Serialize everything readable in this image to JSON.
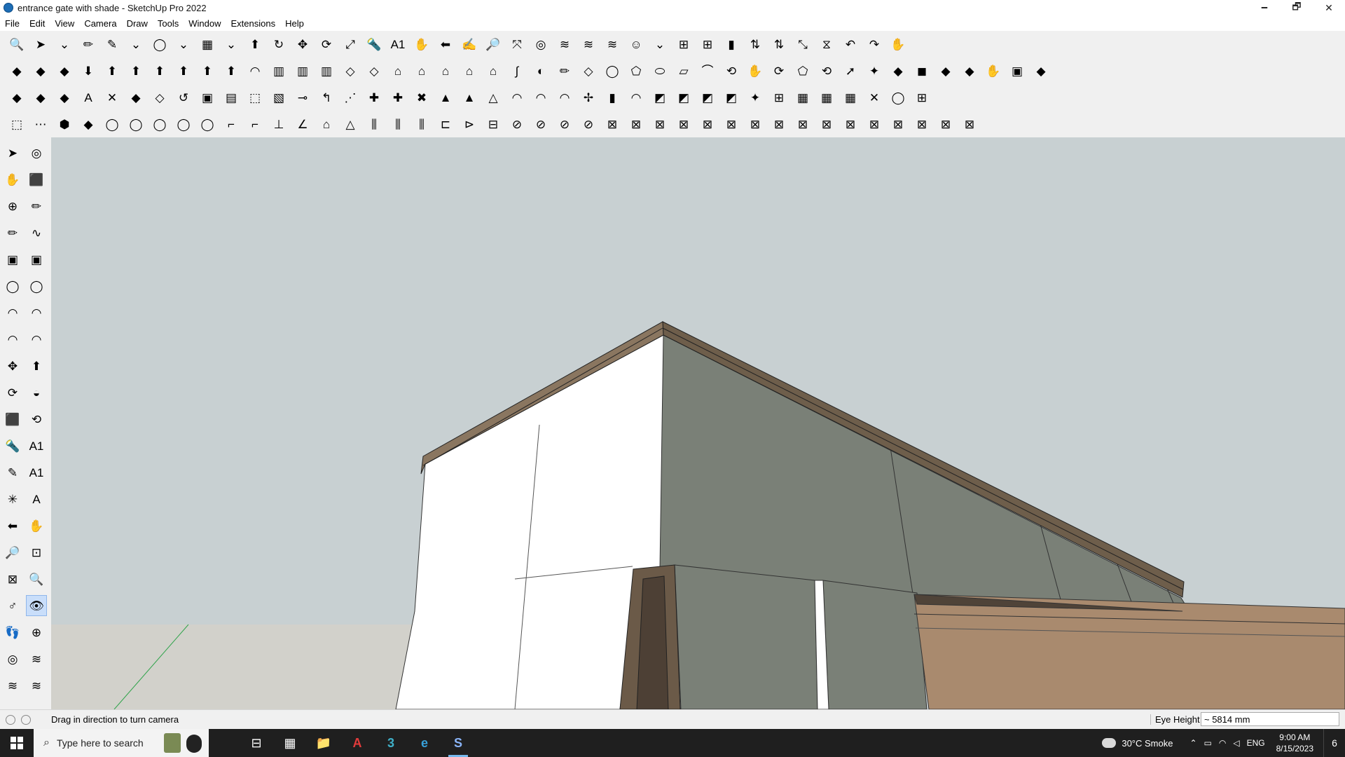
{
  "window": {
    "title": "entrance gate with shade - SketchUp Pro 2022",
    "minimize": "🗕",
    "restore": "🗗",
    "close": "✕"
  },
  "menu": [
    "File",
    "Edit",
    "View",
    "Camera",
    "Draw",
    "Tools",
    "Window",
    "Extensions",
    "Help"
  ],
  "status": {
    "hint": "Drag in direction to turn camera",
    "measure_label": "Eye Height",
    "measure_value": "~ 5814 mm"
  },
  "taskbar": {
    "search_placeholder": "Type here to search",
    "weather": "30°C  Smoke",
    "language": "ENG",
    "time": "9:00 AM",
    "date": "8/15/2023",
    "notifications": "6"
  },
  "toolbar_rows": [
    [
      "🔍",
      "➤",
      "⌄",
      "✏",
      "✎",
      "⌄",
      "◯",
      "⌄",
      "▦",
      "⌄",
      "⬆",
      "↻",
      "✥",
      "⟳",
      "⤢",
      "🔦",
      "A1",
      "✋",
      "⬅",
      "✍",
      "🔎",
      "⤧",
      "◎",
      "≋",
      "≋",
      "≋",
      "☺",
      "⌄",
      "⊞",
      "⊞",
      "▮",
      "⇅",
      "⇅",
      "⤡",
      "⧖",
      "↶",
      "↷",
      "✋"
    ],
    [
      "◆",
      "◆",
      "◆",
      "⬇",
      "⬆",
      "⬆",
      "⬆",
      "⬆",
      "⬆",
      "⬆",
      "◠",
      "▥",
      "▥",
      "▥",
      "◇",
      "◇",
      "⌂",
      "⌂",
      "⌂",
      "⌂",
      "⌂",
      "∫",
      "◐",
      "✏",
      "◇",
      "◯",
      "⬠",
      "⬭",
      "▱",
      "⌒",
      "⟲",
      "✋",
      "⟳",
      "⬠",
      "⟲",
      "➚",
      "✦",
      "◆",
      "◼",
      "◆",
      "◆",
      "✋",
      "▣",
      "◆"
    ],
    [
      "◆",
      "◆",
      "◆",
      "A",
      "✕",
      "◆",
      "◇",
      "↺",
      "▣",
      "▤",
      "⬚",
      "▧",
      "⊸",
      "↰",
      "⋰",
      "✚",
      "✚",
      "✖",
      "▲",
      "▲",
      "△",
      "◠",
      "◠",
      "◠",
      "✢",
      "▮",
      "◠",
      "◩",
      "◩",
      "◩",
      "◩",
      "✦",
      "⊞",
      "▦",
      "▦",
      "▦",
      "✕",
      "◯",
      "⊞"
    ],
    [
      "⬚",
      "⋯",
      "⬢",
      "◆",
      "◯",
      "◯",
      "◯",
      "◯",
      "◯",
      "⌐",
      "⌐",
      "⊥",
      "∠",
      "⌂",
      "△",
      "⫼",
      "⫼",
      "⫼",
      "⊏",
      "⊳",
      "⊟",
      "⊘",
      "⊘",
      "⊘",
      "⊘",
      "⊠",
      "⊠",
      "⊠",
      "⊠",
      "⊠",
      "⊠",
      "⊠",
      "⊠",
      "⊠",
      "⊠",
      "⊠",
      "⊠",
      "⊠",
      "⊠",
      "⊠",
      "⊠"
    ]
  ],
  "left_tools": [
    "➤",
    "◎",
    "✋",
    "⬛",
    "⊕",
    "✏",
    "✏",
    "∿",
    "▣",
    "▣",
    "◯",
    "◯",
    "◠",
    "◠",
    "◠",
    "◠",
    "✥",
    "⬆",
    "⟳",
    "◒",
    "⬛",
    "⟲",
    "🔦",
    "A1",
    "✎",
    "A1",
    "✳",
    "A",
    "⬅",
    "✋",
    "🔎",
    "⊡",
    "⊠",
    "🔍",
    "♂",
    "👁",
    "👣",
    "⊕",
    "◎",
    "≋",
    "≋",
    "≋"
  ],
  "taskbar_apps": [
    "⊟",
    "▦",
    "📁",
    "A",
    "3",
    "e",
    "S"
  ],
  "colors": {
    "sky": "#c8d0d2",
    "ground": "#d2d1cb",
    "white_wall": "#ffffff",
    "green_wall": "#7a8077",
    "cornice": "#7b6a56",
    "canopy": "#a98a6e",
    "axis_green": "#2ea34a"
  }
}
